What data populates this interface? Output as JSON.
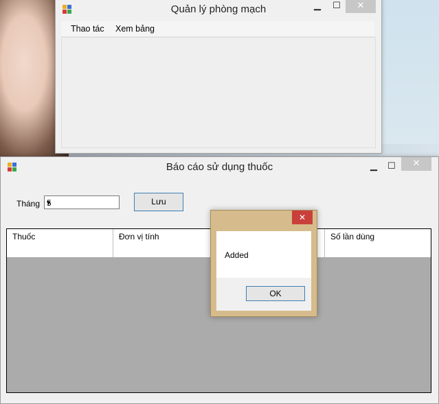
{
  "main_window": {
    "title": "Quản lý phòng mạch",
    "controls": {
      "minimize": "▁",
      "maximize": "☐",
      "close": "✕"
    },
    "menu": [
      "Thao tác",
      "Xem bảng"
    ]
  },
  "report_window": {
    "title": "Báo cáo sử dụng thuốc",
    "controls": {
      "minimize": "▁",
      "maximize": "☐",
      "close": "✕"
    },
    "month_label": "Tháng",
    "month_value": "5",
    "save_label": "Lưu",
    "grid": {
      "columns": [
        "Thuốc",
        "Đơn vị tính",
        "",
        "Số lần dùng"
      ],
      "rows": [
        [
          "",
          "",
          "",
          ""
        ]
      ]
    }
  },
  "message_box": {
    "close": "✕",
    "text": "Added",
    "ok_label": "OK"
  },
  "colors": {
    "message_frame": "#d6bc8c",
    "close_red": "#c9403b",
    "grid_background": "#ababab",
    "button_border": "#3c7fb1"
  },
  "icons": {
    "app_icon": "app-icon",
    "dropdown": "chevron-down-icon",
    "close": "close-icon",
    "minimize": "minimize-icon",
    "maximize": "maximize-icon"
  }
}
